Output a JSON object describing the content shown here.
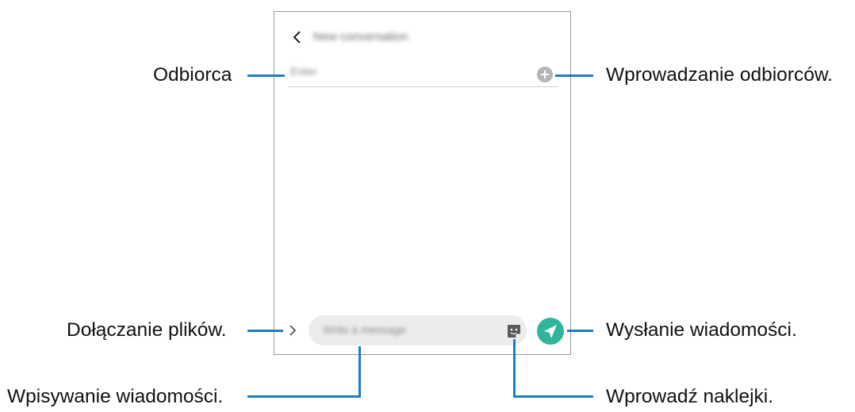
{
  "labels": {
    "recipient": "Odbiorca",
    "add_recipients": "Wprowadzanie odbiorców.",
    "attach_files": "Dołączanie plików.",
    "send_message": "Wysłanie wiadomości.",
    "type_message": "Wpisywanie wiadomości.",
    "stickers": "Wprowadź naklejki."
  },
  "screen": {
    "title": "New conversation",
    "recipient_placeholder": "Enter",
    "message_placeholder": "Write a message"
  },
  "colors": {
    "callout": "#1d7fc2",
    "send_button": "#2fb59b",
    "add_button": "#b5b5b5"
  },
  "icons": [
    "back-icon",
    "add-recipient-icon",
    "attach-chevron-icon",
    "sticker-icon",
    "send-icon"
  ]
}
